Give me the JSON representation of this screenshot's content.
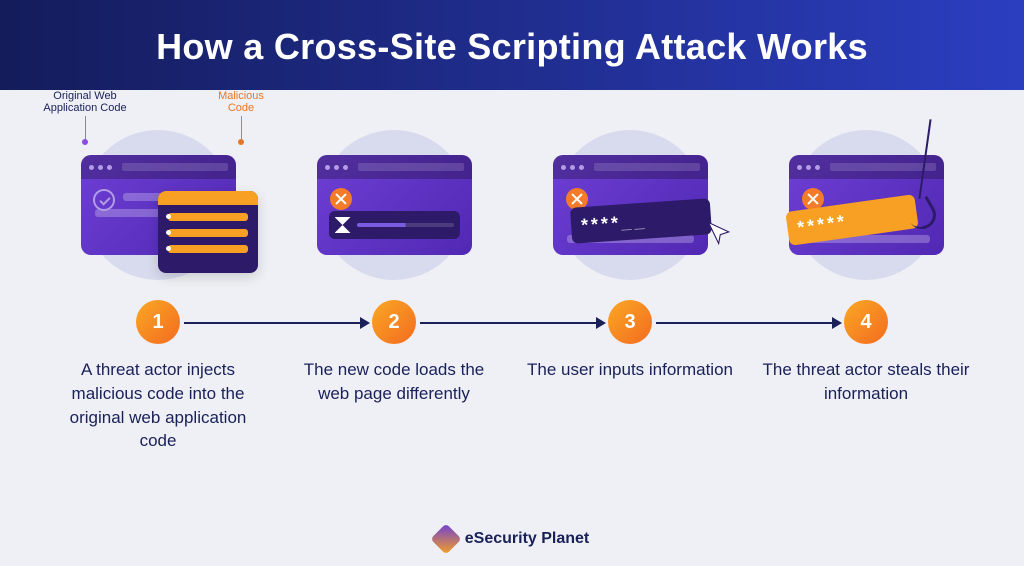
{
  "header": {
    "title": "How a Cross-Site Scripting Attack Works"
  },
  "labels": {
    "original": "Original Web\nApplication Code",
    "malicious": "Malicious\nCode"
  },
  "steps": [
    {
      "num": "1",
      "desc": "A threat actor injects malicious code into the original web application code"
    },
    {
      "num": "2",
      "desc": "The new code loads the web page differently"
    },
    {
      "num": "3",
      "desc": "The user inputs information"
    },
    {
      "num": "4",
      "desc": "The threat actor steals their information"
    }
  ],
  "password_mask": "****",
  "footer": {
    "brand": "eSecurity Planet"
  },
  "colors": {
    "header_start": "#141c5b",
    "header_end": "#2b3ec0",
    "accent_orange": "#f7a024",
    "text_navy": "#1a2058",
    "browser_purple": "#6d3fd4"
  }
}
